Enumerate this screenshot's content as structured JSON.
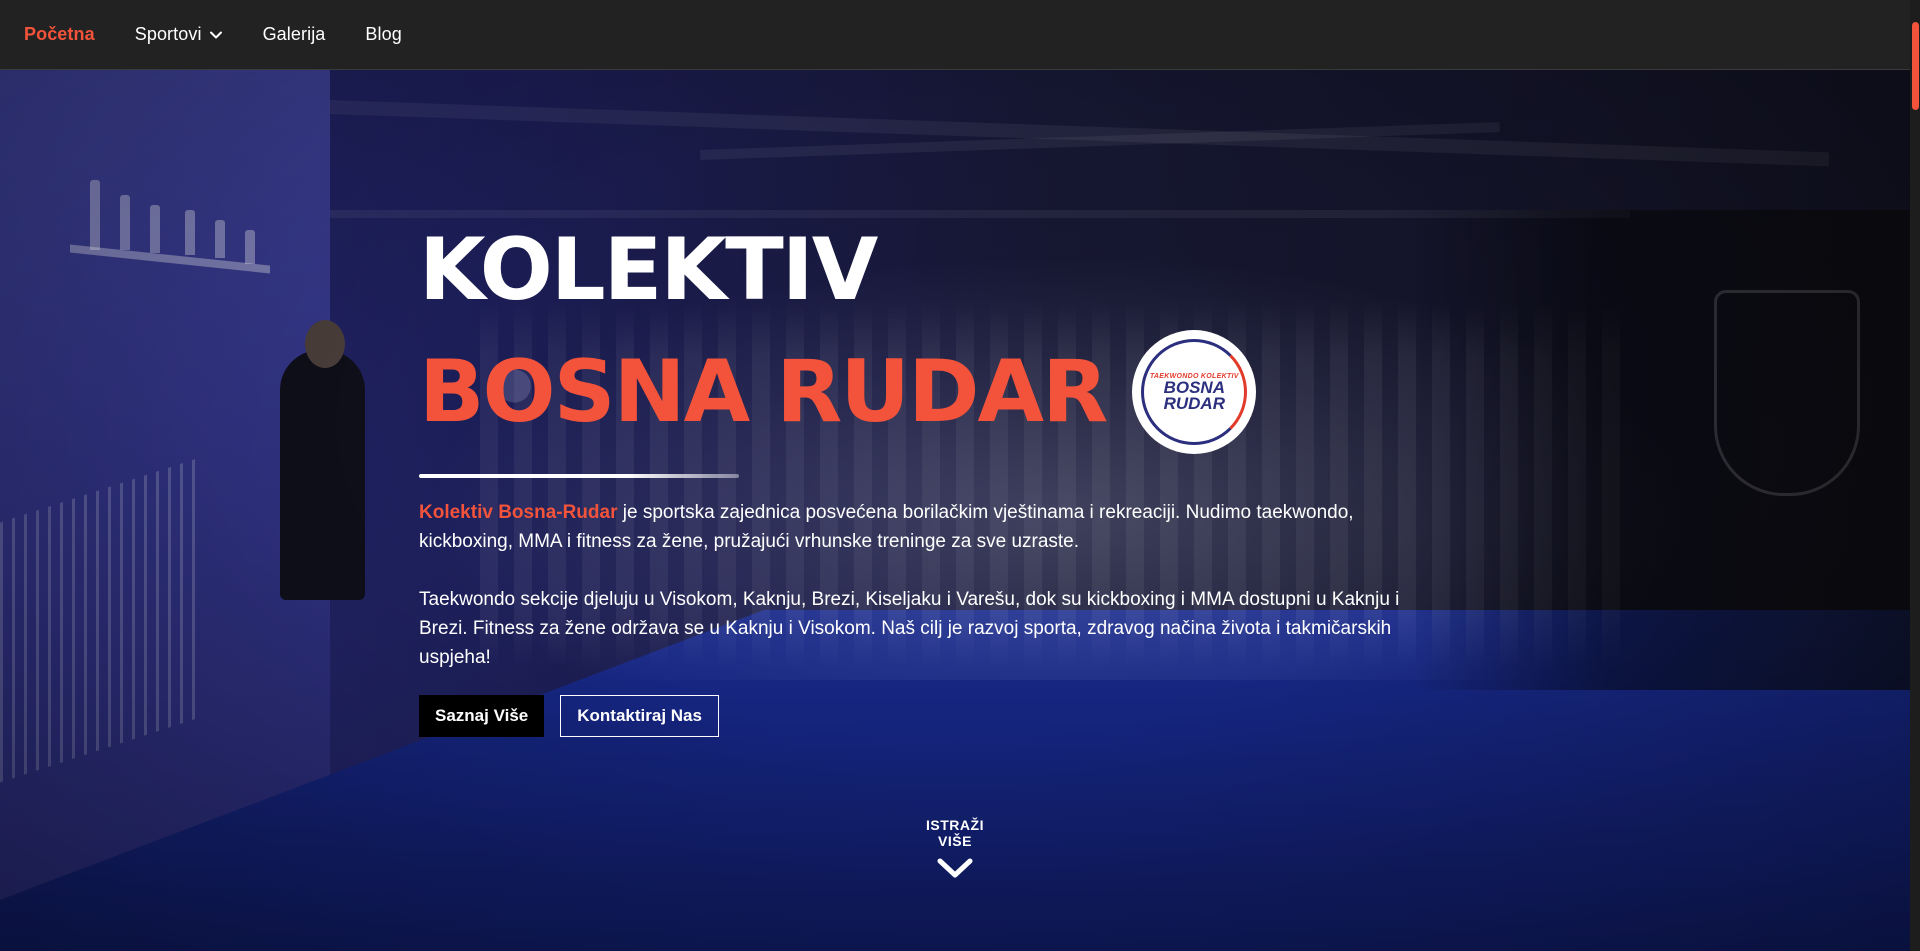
{
  "nav": {
    "items": [
      {
        "label": "Početna",
        "active": true
      },
      {
        "label": "Sportovi",
        "dropdown": true
      },
      {
        "label": "Galerija"
      },
      {
        "label": "Blog"
      }
    ]
  },
  "hero": {
    "title_line1": "KOLEKTIV",
    "title_line2": "BOSNA RUDAR",
    "logo": {
      "small_text": "TAEKWONDO KOLEKTIV",
      "line1": "BOSNA",
      "line2": "RUDAR"
    },
    "paragraph1": {
      "highlight": "Kolektiv Bosna-Rudar",
      "text": " je sportska zajednica posvećena borilačkim vještinama i rekreaciji. Nudimo taekwondo, kickboxing, MMA i fitness za žene, pružajući vrhunske treninge za sve uzraste."
    },
    "paragraph2": "Taekwondo sekcije djeluju u Visokom, Kaknju, Brezi, Kiseljaku i Varešu, dok su kickboxing i MMA dostupni u Kaknju i Brezi. Fitness za žene održava se u Kaknju i Visokom. Naš cilj je razvoj sporta, zdravog načina života i takmičarskih uspjeha!",
    "buttons": {
      "primary": "Saznaj Više",
      "secondary": "Kontaktiraj Nas"
    },
    "scroll_cue": "ISTRAŽI VIŠE"
  },
  "colors": {
    "accent": "#f2533a",
    "nav_bg": "#222222",
    "hero_overlay": "#1d1f5a"
  }
}
